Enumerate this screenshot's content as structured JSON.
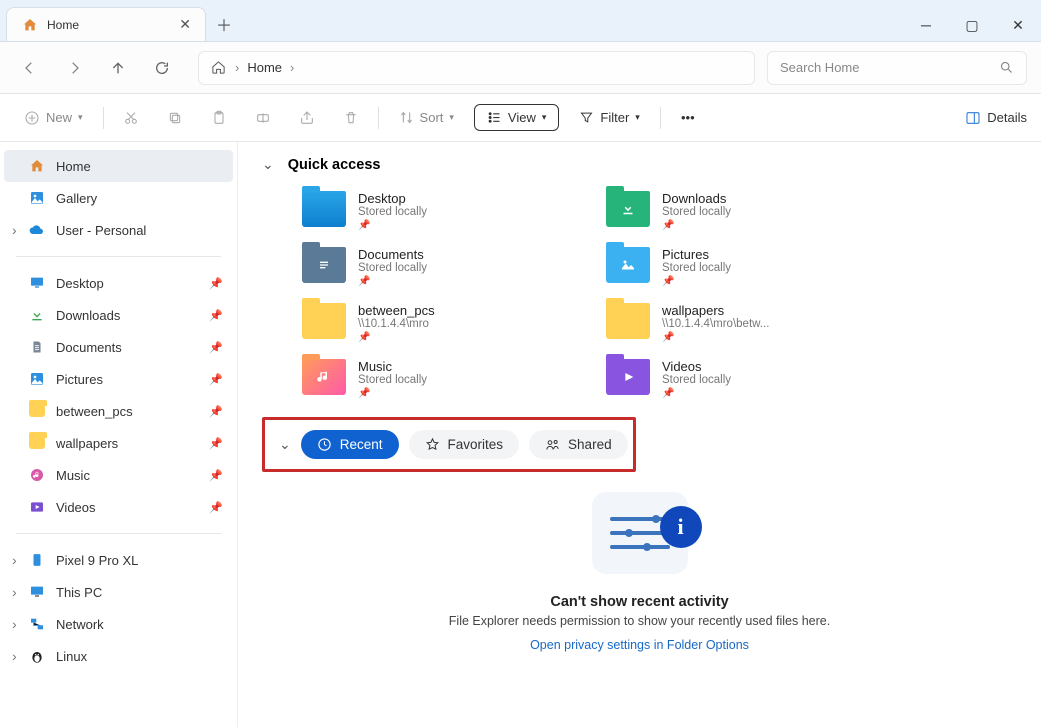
{
  "titlebar": {
    "tab_title": "Home"
  },
  "address": {
    "crumb1": "Home",
    "sep": "›"
  },
  "search": {
    "placeholder": "Search Home"
  },
  "toolbar": {
    "new": "New",
    "sort": "Sort",
    "view": "View",
    "filter": "Filter",
    "details": "Details"
  },
  "sidebar": {
    "home": "Home",
    "gallery": "Gallery",
    "user": "User - Personal",
    "desktop": "Desktop",
    "downloads": "Downloads",
    "documents": "Documents",
    "pictures": "Pictures",
    "between": "between_pcs",
    "wallpapers": "wallpapers",
    "music": "Music",
    "videos": "Videos",
    "pixel": "Pixel 9 Pro XL",
    "thispc": "This PC",
    "network": "Network",
    "linux": "Linux"
  },
  "quick_access": {
    "title": "Quick access",
    "items": [
      {
        "name": "Desktop",
        "sub": "Stored locally"
      },
      {
        "name": "Downloads",
        "sub": "Stored locally"
      },
      {
        "name": "Documents",
        "sub": "Stored locally"
      },
      {
        "name": "Pictures",
        "sub": "Stored locally"
      },
      {
        "name": "between_pcs",
        "sub": "\\\\10.1.4.4\\mro"
      },
      {
        "name": "wallpapers",
        "sub": "\\\\10.1.4.4\\mro\\betw..."
      },
      {
        "name": "Music",
        "sub": "Stored locally"
      },
      {
        "name": "Videos",
        "sub": "Stored locally"
      }
    ]
  },
  "tabs": {
    "recent": "Recent",
    "favorites": "Favorites",
    "shared": "Shared"
  },
  "empty": {
    "title": "Can't show recent activity",
    "sub": "File Explorer needs permission to show your recently used files here.",
    "link": "Open privacy settings in Folder Options"
  }
}
